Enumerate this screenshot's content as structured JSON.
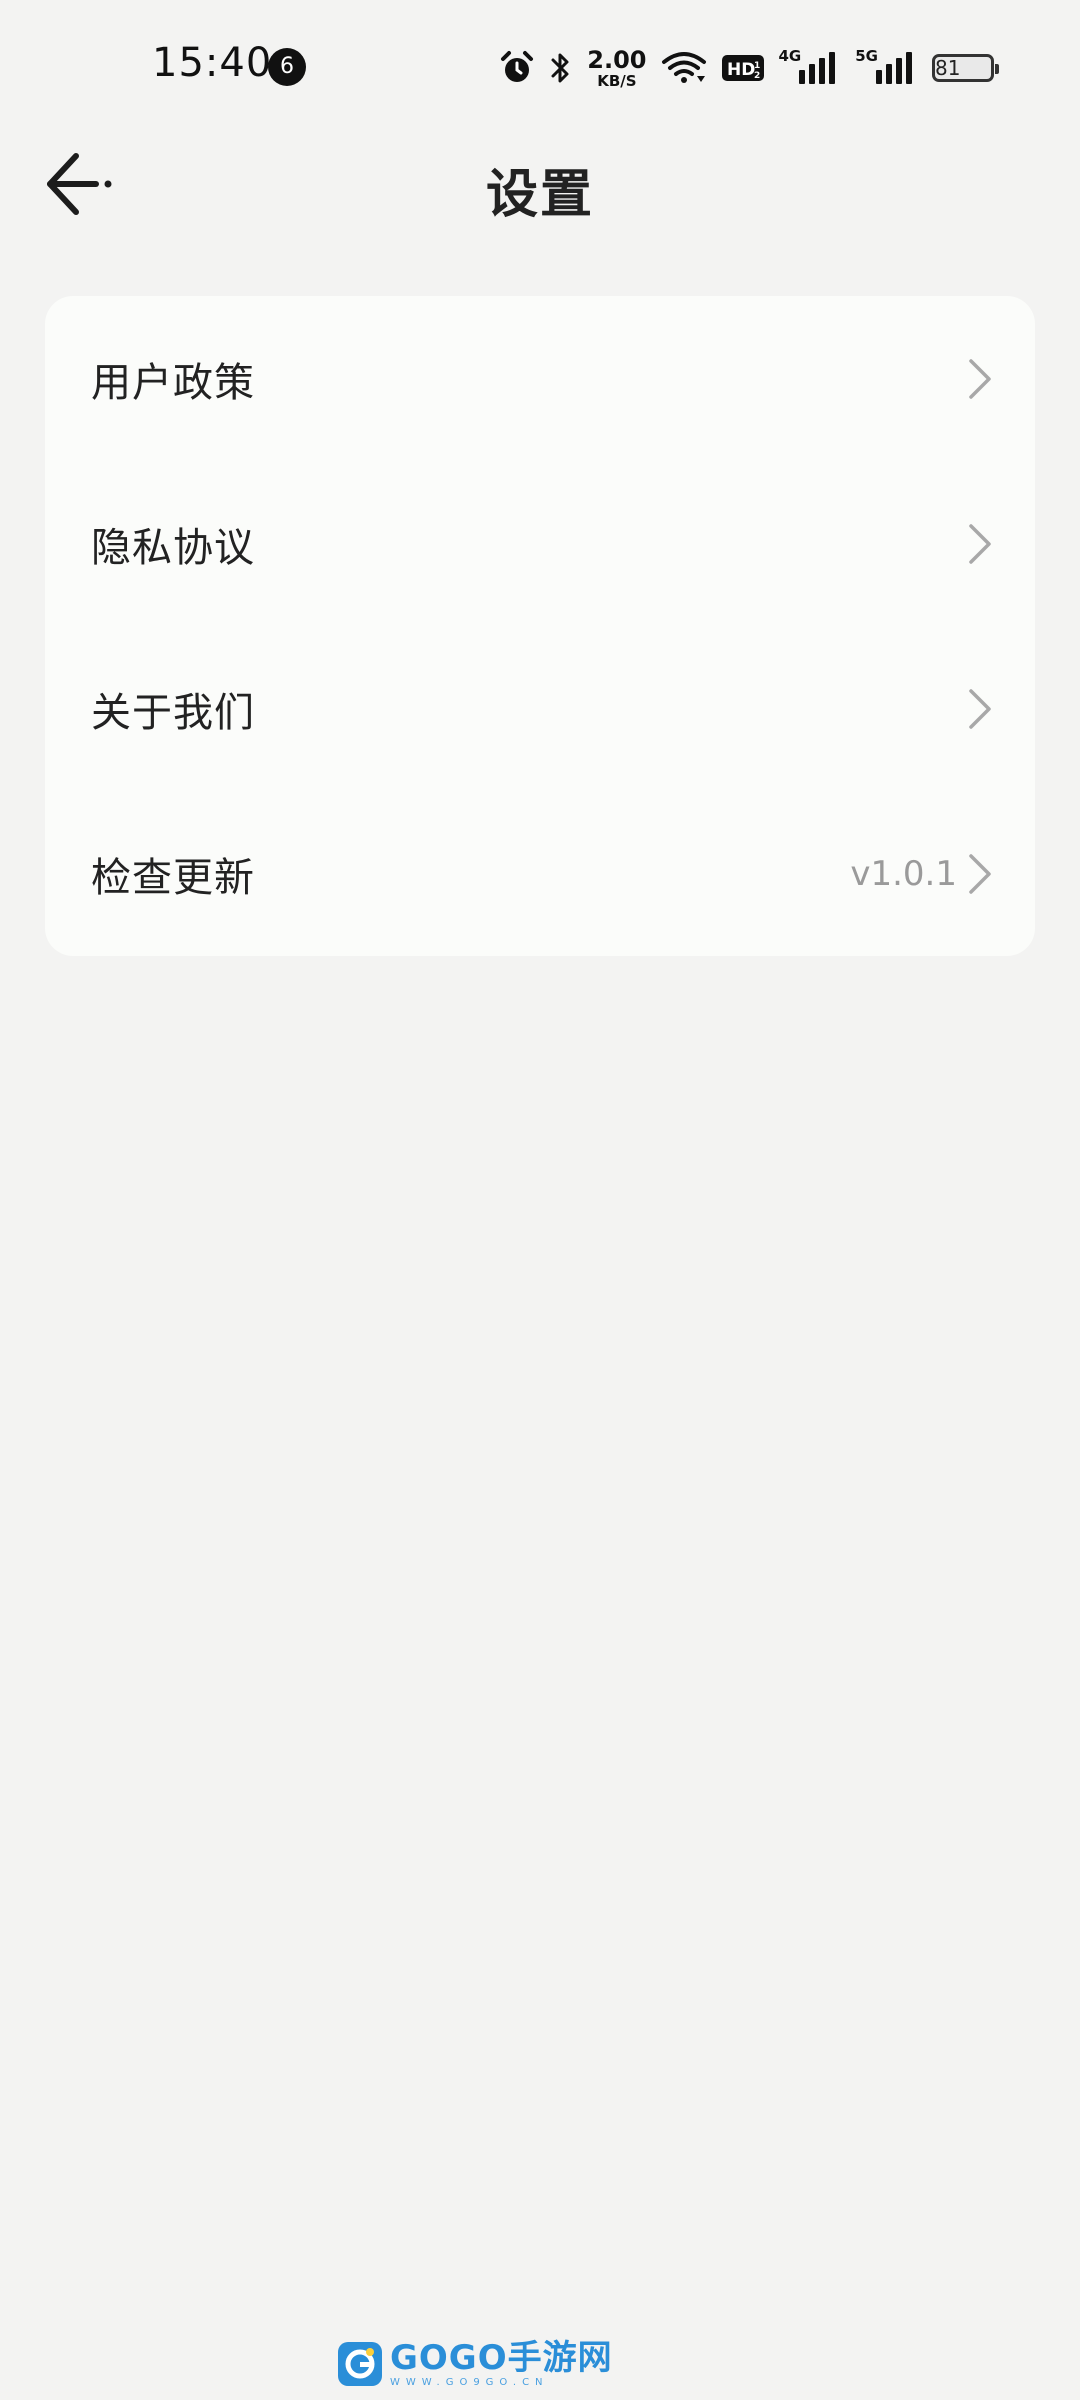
{
  "status_bar": {
    "time": "15:40",
    "notification_count": "6",
    "network_speed": "2.00",
    "network_speed_unit": "KB/S",
    "hd_label": "HD",
    "network_4g": "4G",
    "network_5g": "5G",
    "battery_level": "81",
    "icons": [
      "alarm-icon",
      "bluetooth-icon",
      "wifi-icon",
      "hd-voice-icon",
      "signal-4g-icon",
      "signal-5g-icon",
      "battery-icon"
    ]
  },
  "header": {
    "title": "设置",
    "back_icon": "back-arrow-icon"
  },
  "settings": {
    "items": [
      {
        "label": "用户政策",
        "value": ""
      },
      {
        "label": "隐私协议",
        "value": ""
      },
      {
        "label": "关于我们",
        "value": ""
      },
      {
        "label": "检查更新",
        "value": "v1.0.1"
      }
    ]
  },
  "watermark": {
    "text": "GOGO手游网",
    "url": "WWW.GO9GO.CN"
  },
  "colors": {
    "background": "#f3f3f2",
    "card": "#fbfcfa",
    "text": "#222222",
    "secondary_text": "#9a9a9a",
    "watermark": "#2a8ed8"
  }
}
